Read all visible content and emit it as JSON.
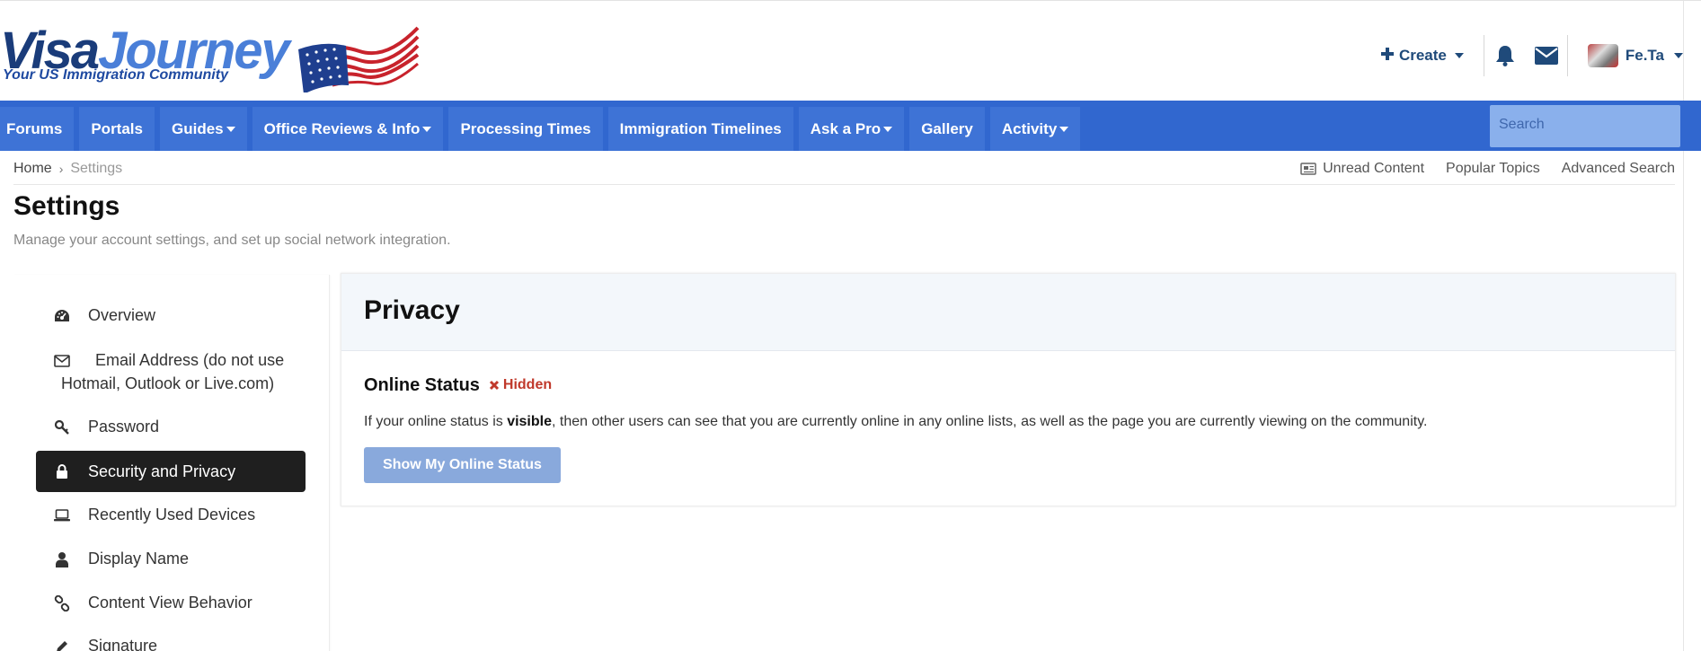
{
  "logo": {
    "word1": "Visa",
    "word2": "Journey",
    "tagline": "Your US Immigration Community"
  },
  "header": {
    "create_label": "Create",
    "user_name": "Fe.Ta"
  },
  "nav": {
    "items": [
      {
        "label": "Forums",
        "dropdown": false
      },
      {
        "label": "Portals",
        "dropdown": false
      },
      {
        "label": "Guides",
        "dropdown": true
      },
      {
        "label": "Office Reviews & Info",
        "dropdown": true
      },
      {
        "label": "Processing Times",
        "dropdown": false
      },
      {
        "label": "Immigration Timelines",
        "dropdown": false
      },
      {
        "label": "Ask a Pro",
        "dropdown": true
      },
      {
        "label": "Gallery",
        "dropdown": false
      },
      {
        "label": "Activity",
        "dropdown": true
      }
    ],
    "search_placeholder": "Search"
  },
  "breadcrumb": {
    "home": "Home",
    "current": "Settings"
  },
  "quick_links": {
    "unread": "Unread Content",
    "popular": "Popular Topics",
    "advanced": "Advanced Search"
  },
  "page": {
    "title": "Settings",
    "description": "Manage your account settings, and set up social network integration."
  },
  "sidebar": {
    "items": [
      {
        "label": "Overview",
        "icon": "dashboard-icon"
      },
      {
        "label": "Email Address (do not use Hotmail, Outlook or Live.com)",
        "icon": "envelope-icon"
      },
      {
        "label": "Password",
        "icon": "key-icon"
      },
      {
        "label": "Security and Privacy",
        "icon": "lock-icon",
        "active": true
      },
      {
        "label": "Recently Used Devices",
        "icon": "laptop-icon"
      },
      {
        "label": "Display Name",
        "icon": "user-icon"
      },
      {
        "label": "Content View Behavior",
        "icon": "link-icon"
      },
      {
        "label": "Signature",
        "icon": "pencil-icon"
      }
    ]
  },
  "privacy": {
    "title": "Privacy",
    "online_status_title": "Online Status",
    "status_badge": "Hidden",
    "desc_before": "If your online status is ",
    "desc_bold": "visible",
    "desc_after": ", then other users can see that you are currently online in any online lists, as well as the page you are currently viewing on the community.",
    "button_label": "Show My Online Status"
  },
  "colors": {
    "nav_bg": "#3167cf",
    "nav_item_bg": "#3e73d6",
    "brand_dark": "#1f4a7a",
    "hidden_red": "#c0392b",
    "button_bg": "#89a9dc"
  }
}
